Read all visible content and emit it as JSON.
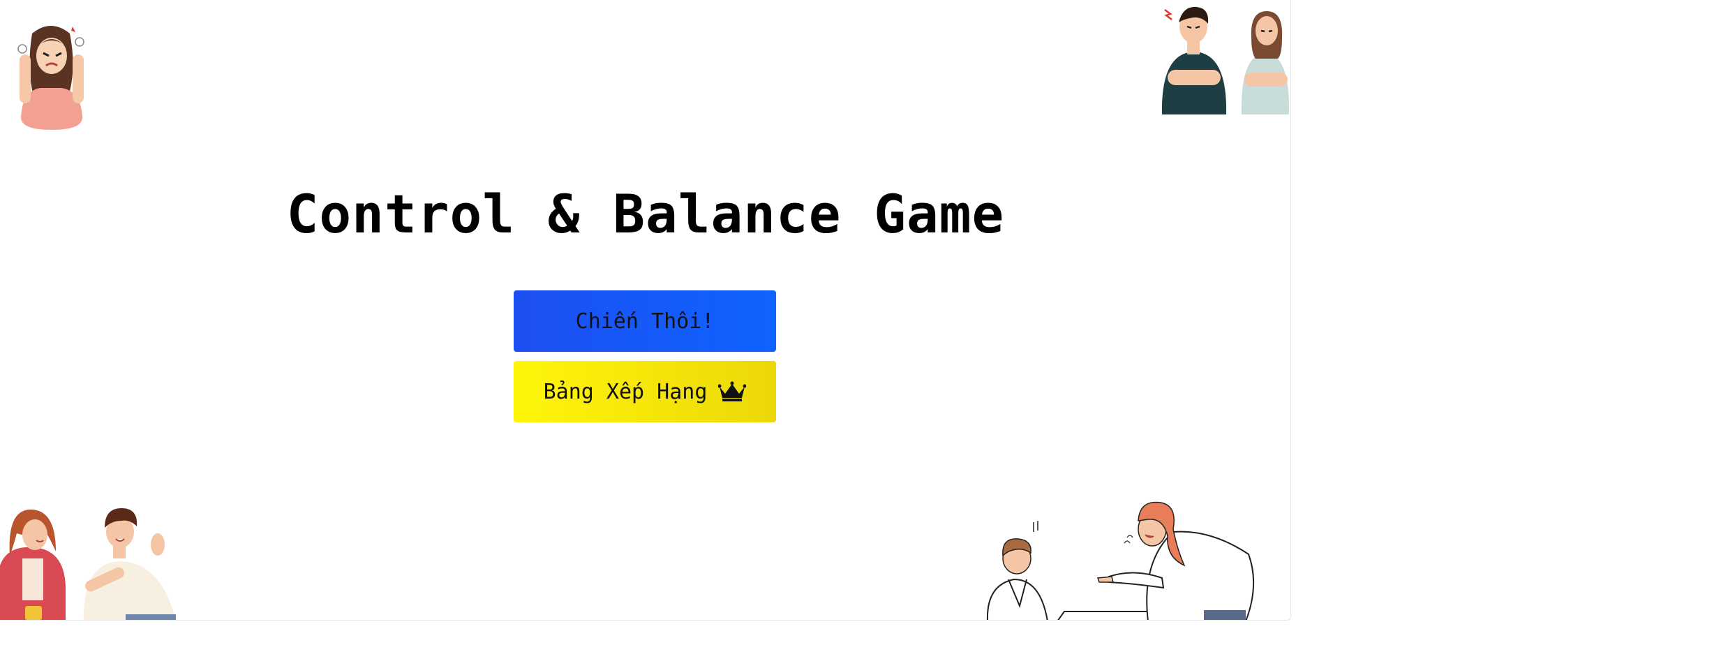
{
  "app": {
    "title": "Control & Balance Game"
  },
  "menu": {
    "play_label": "Chiến Thôi!",
    "leaderboard_label": "Bảng Xếp Hạng"
  },
  "icons": {
    "leaderboard": "crown-icon"
  },
  "colors": {
    "play_button": "#1f5cff",
    "leaderboard_button": "#f7ea0a",
    "title_text": "#000000",
    "background": "#ffffff"
  }
}
